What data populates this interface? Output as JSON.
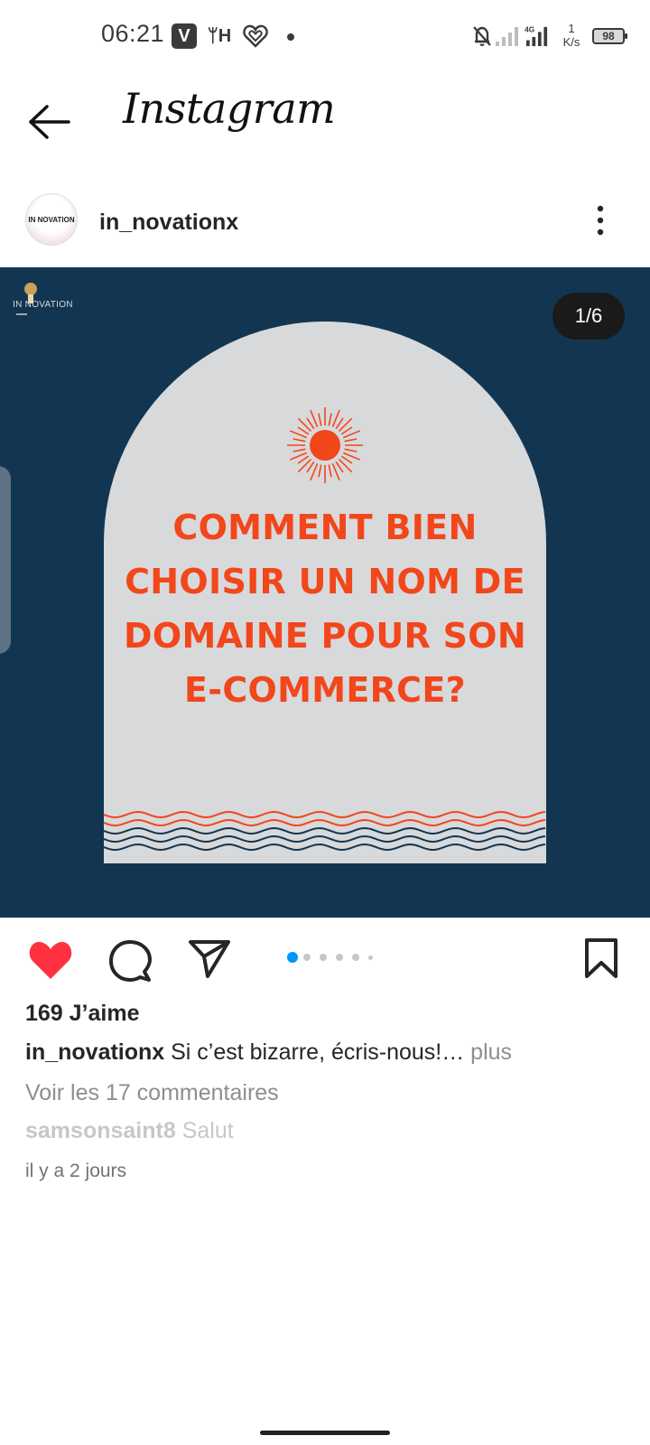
{
  "status_bar": {
    "time": "06:21",
    "app_icons": [
      "V",
      "YH",
      "heart-outline"
    ],
    "network_type": "4G",
    "speed_value": "1",
    "speed_unit": "K/s",
    "battery": "98"
  },
  "header": {
    "title": "Instagram"
  },
  "post": {
    "username": "in_novationx",
    "avatar_text": "IN NOVATION",
    "image": {
      "brand_text": "IN NOVATION",
      "carousel_counter": "1/6",
      "headline": "COMMENT BIEN CHOISIR UN NOM DE DOMAINE POUR SON E-COMMERCE?",
      "background_color": "#123651",
      "arch_color": "#d8d9db",
      "accent_color": "#f2461b"
    },
    "carousel": {
      "total": 6,
      "active_index": 0,
      "active_color": "#0095f6"
    },
    "likes_text": "169 J’aime",
    "caption": {
      "username": "in_novationx",
      "text": " Si c’est bizarre, écris-nous!…",
      "more": " plus"
    },
    "view_comments": "Voir les 17 commentaires",
    "preview_comment": {
      "username": "samsonsaint8",
      "text": " Salut"
    },
    "timestamp": "il y a 2 jours"
  },
  "icons": {
    "like": "heart-filled-icon",
    "like_color": "#ff3040",
    "comment": "comment-icon",
    "share": "send-icon",
    "save": "bookmark-icon"
  }
}
